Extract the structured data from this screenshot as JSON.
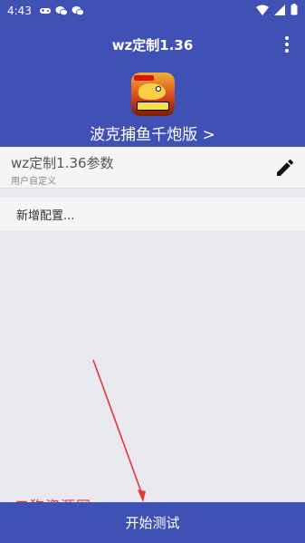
{
  "status_bar": {
    "time": "4:43",
    "icons": [
      "gamepad-icon",
      "wechat-icon",
      "wechat-icon",
      "wifi-icon",
      "signal-icon",
      "battery-icon"
    ]
  },
  "app_bar": {
    "title": "wz定制1.36",
    "menu_icon": "more-vert-icon"
  },
  "header": {
    "game_title": "波克捕鱼千炮版 >",
    "app_icon": "fish-game-icon"
  },
  "config_row": {
    "name": "wz定制1.36参数",
    "subtitle": "用户自定义",
    "edit_icon": "pencil-icon"
  },
  "add_config": {
    "label": "新增配置..."
  },
  "watermark": {
    "text": "二狗资源网"
  },
  "bottom_button": {
    "label": "开始测试"
  },
  "colors": {
    "primary": "#3f51b5",
    "background": "#e9e9ef",
    "row_bg": "#f5f5f5",
    "annotation": "#e53935"
  }
}
